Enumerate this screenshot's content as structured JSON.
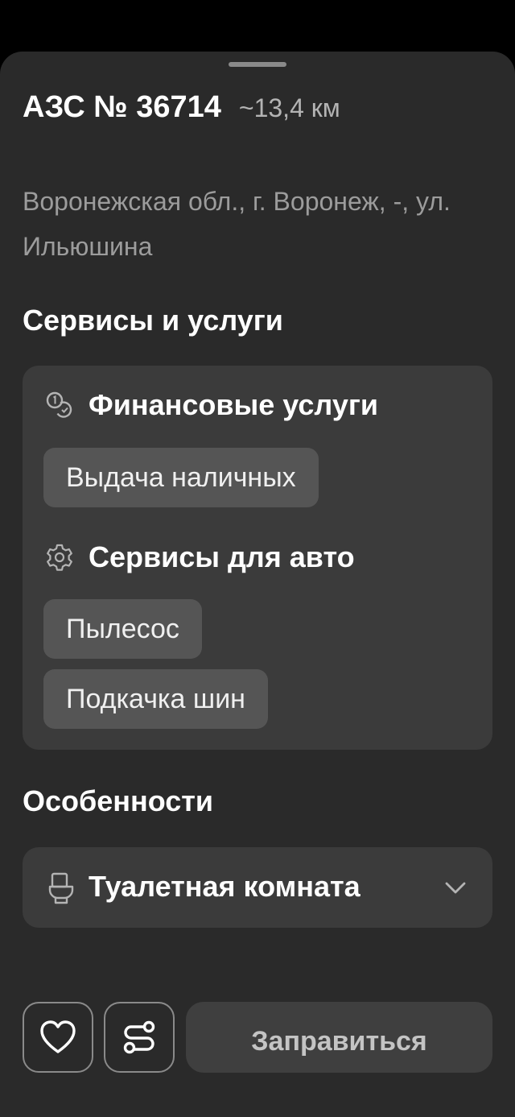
{
  "station": {
    "title": "АЗС № 36714",
    "distance": "~13,4 км",
    "address": "Воронежская обл., г. Воронеж, -, ул. Ильюшина"
  },
  "services": {
    "section_title": "Сервисы и услуги",
    "groups": [
      {
        "title": "Финансовые услуги",
        "icon": "coins-icon",
        "items": [
          "Выдача наличных"
        ]
      },
      {
        "title": "Сервисы для авто",
        "icon": "gear-icon",
        "items": [
          "Пылесос",
          "Подкачка шин"
        ]
      }
    ]
  },
  "features": {
    "section_title": "Особенности",
    "items": [
      {
        "label": "Туалетная комната",
        "icon": "toilet-icon"
      }
    ]
  },
  "actions": {
    "favorite_icon": "heart-icon",
    "route_icon": "route-icon",
    "refuel_label": "Заправиться"
  },
  "colors": {
    "sheet_background": "#2a2a2a",
    "card_background": "#3b3b3b",
    "chip_background": "#555555"
  }
}
